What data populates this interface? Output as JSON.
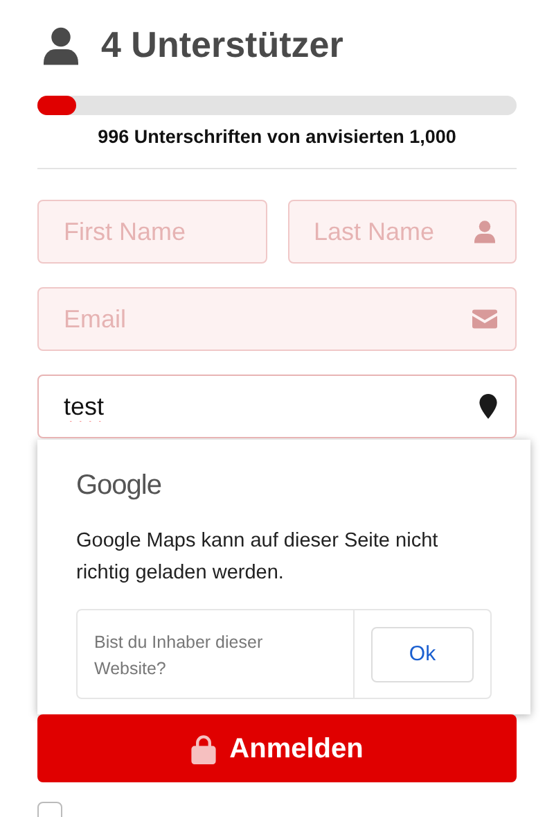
{
  "header": {
    "title": "4 Unterstützer"
  },
  "progress": {
    "level": 0.08,
    "caption": "996 Unterschriften von anvisierten 1,000"
  },
  "fields": [
    {
      "kind": "first",
      "placeholder": "First Name"
    },
    {
      "kind": "last",
      "placeholder": "Last Name"
    },
    {
      "kind": "email",
      "placeholder": "Email"
    },
    {
      "kind": "address",
      "value": "test"
    }
  ],
  "maps_error": {
    "brand": "Google",
    "message": "Google Maps kann auf dieser Seite nicht richtig geladen werden.",
    "question": "Bist du Inhaber dieser Website?",
    "button": "Ok"
  },
  "submit": {
    "label": "Anmelden"
  },
  "consent": {
    "checked": false
  }
}
